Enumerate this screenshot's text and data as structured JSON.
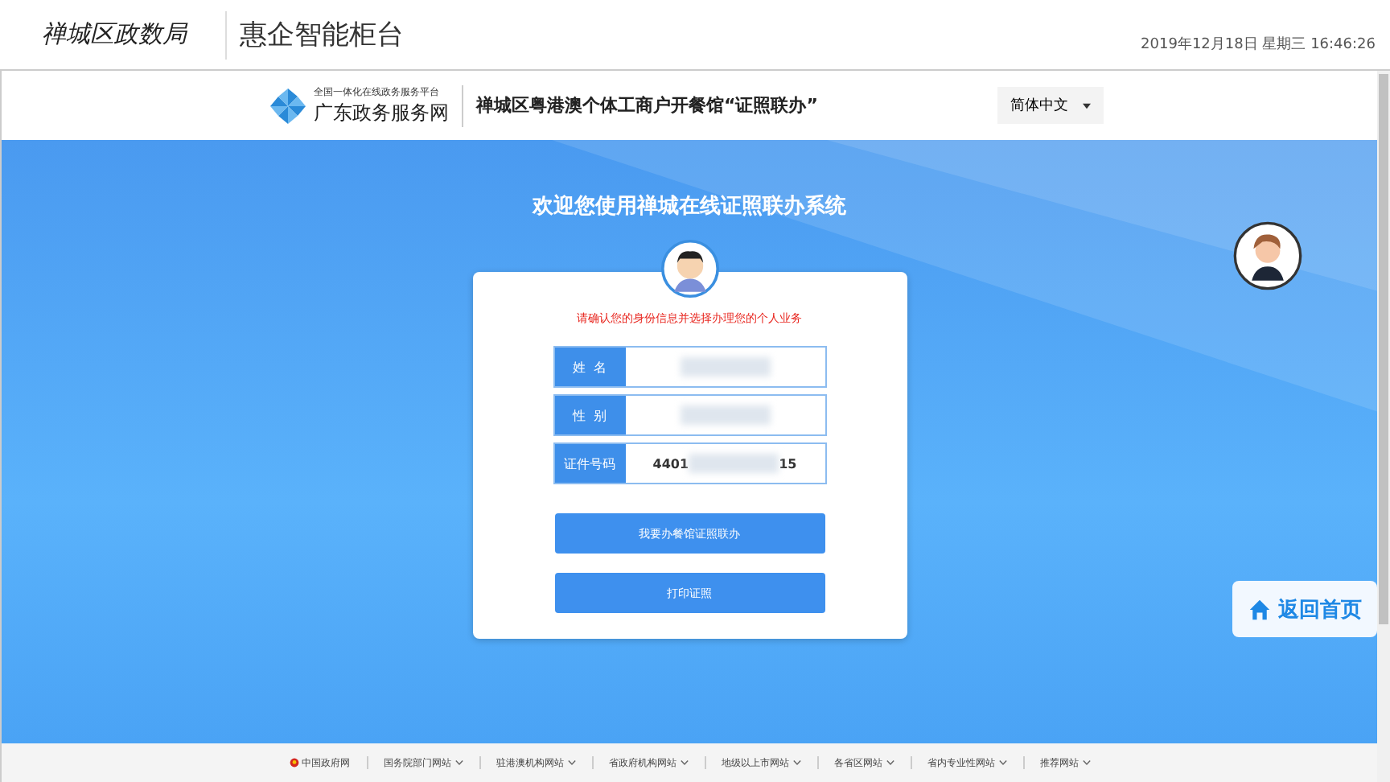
{
  "top_bar": {
    "logo_text": "禅城区政数局",
    "title": "惠企智能柜台",
    "datetime": "2019年12月18日 星期三 16:46:26"
  },
  "site_header": {
    "platform_subtitle": "全国一体化在线政务服务平台",
    "platform_name": "广东政务服务网",
    "page_title": "禅城区粤港澳个体工商户开餐馆“证照联办”",
    "language_select": "简体中文"
  },
  "welcome_title": "欢迎您使用禅城在线证照联办系统",
  "card": {
    "notice": "请确认您的身份信息并选择办理您的个人业务",
    "fields": [
      {
        "label": "姓  名",
        "redacted": true
      },
      {
        "label": "性  别",
        "redacted": true
      },
      {
        "label": "证件号码",
        "value_start": "4401",
        "value_end": "15",
        "redacted": true
      }
    ],
    "buttons": [
      "我要办餐馆证照联办",
      "打印证照"
    ]
  },
  "home_button": "返回首页",
  "footer_links": [
    {
      "label": "中国政府网",
      "kind": "emblem"
    },
    {
      "label": "国务院部门网站",
      "kind": "menu"
    },
    {
      "label": "驻港澳机构网站",
      "kind": "menu"
    },
    {
      "label": "省政府机构网站",
      "kind": "menu"
    },
    {
      "label": "地级以上市网站",
      "kind": "menu"
    },
    {
      "label": "各省区网站",
      "kind": "menu"
    },
    {
      "label": "省内专业性网站",
      "kind": "menu"
    },
    {
      "label": "推荐网站",
      "kind": "menu"
    }
  ]
}
